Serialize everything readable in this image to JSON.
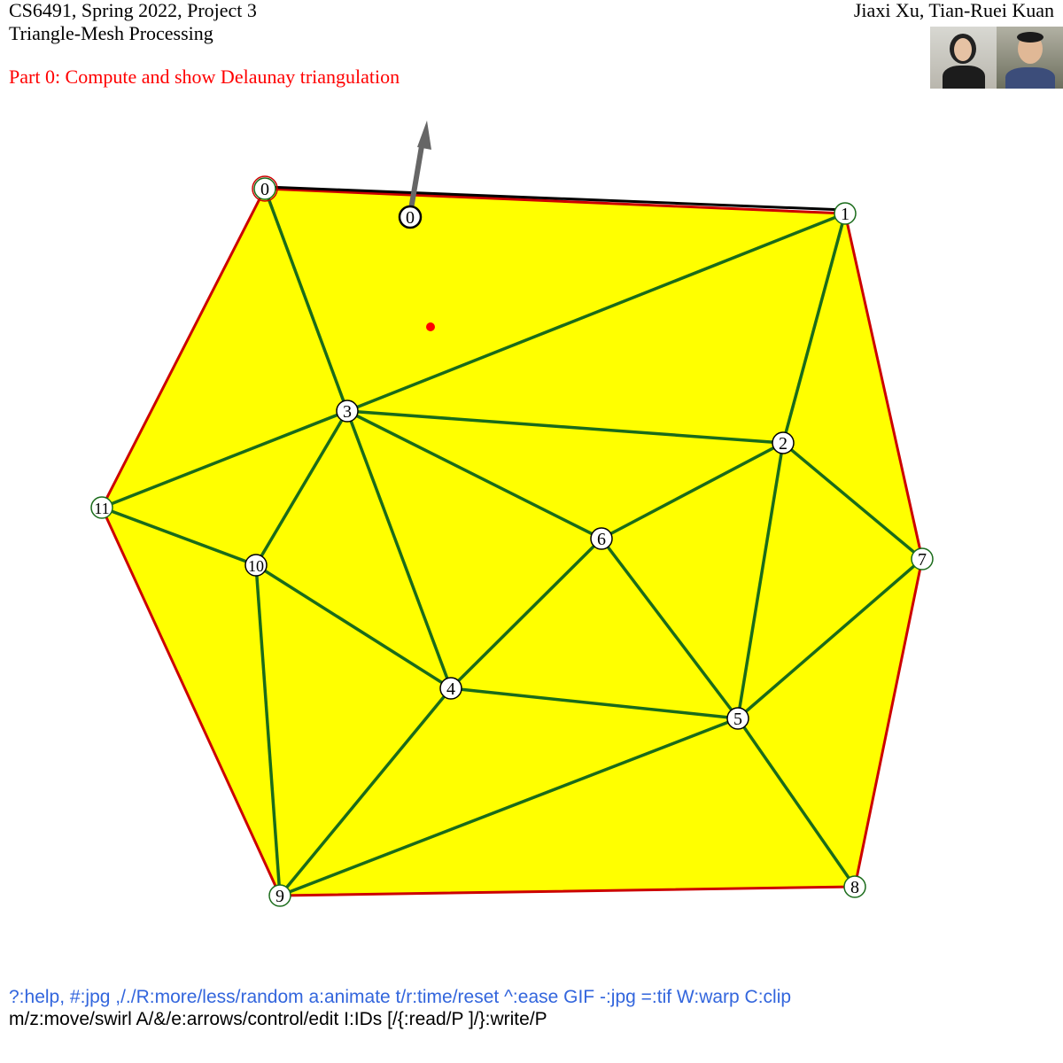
{
  "header": {
    "course": "CS6491, Spring 2022, Project 3",
    "subtitle": "Triangle-Mesh Processing",
    "part": "Part 0: Compute and show Delaunay triangulation",
    "authors": "Jiaxi Xu, Tian-Ruei Kuan"
  },
  "colors": {
    "fill": "#ffff00",
    "edge": "#1a6b1a",
    "border": "#cc0000",
    "arrow": "#666666",
    "marker": "#ff0000"
  },
  "mesh": {
    "vertex_labels": [
      "0",
      "1",
      "2",
      "3",
      "4",
      "5",
      "6",
      "7",
      "8",
      "9",
      "10",
      "11"
    ],
    "hull": [
      0,
      1,
      7,
      8,
      9,
      11
    ],
    "edges": [
      [
        0,
        3
      ],
      [
        1,
        3
      ],
      [
        1,
        2
      ],
      [
        3,
        11
      ],
      [
        3,
        10
      ],
      [
        3,
        4
      ],
      [
        3,
        2
      ],
      [
        3,
        6
      ],
      [
        6,
        2
      ],
      [
        6,
        4
      ],
      [
        6,
        5
      ],
      [
        2,
        5
      ],
      [
        2,
        7
      ],
      [
        5,
        7
      ],
      [
        11,
        10
      ],
      [
        10,
        4
      ],
      [
        10,
        9
      ],
      [
        4,
        5
      ],
      [
        4,
        9
      ],
      [
        9,
        5
      ],
      [
        5,
        8
      ]
    ],
    "arrow_label": "0"
  },
  "footer": {
    "line1": "?:help, #:jpg ,/./R:more/less/random a:animate t/r:time/reset ^:ease GIF -:jpg =:tif W:warp C:clip",
    "line2": "m/z:move/swirl A/&/e:arrows/control/edit I:IDs [/{:read/P ]/}:write/P"
  }
}
